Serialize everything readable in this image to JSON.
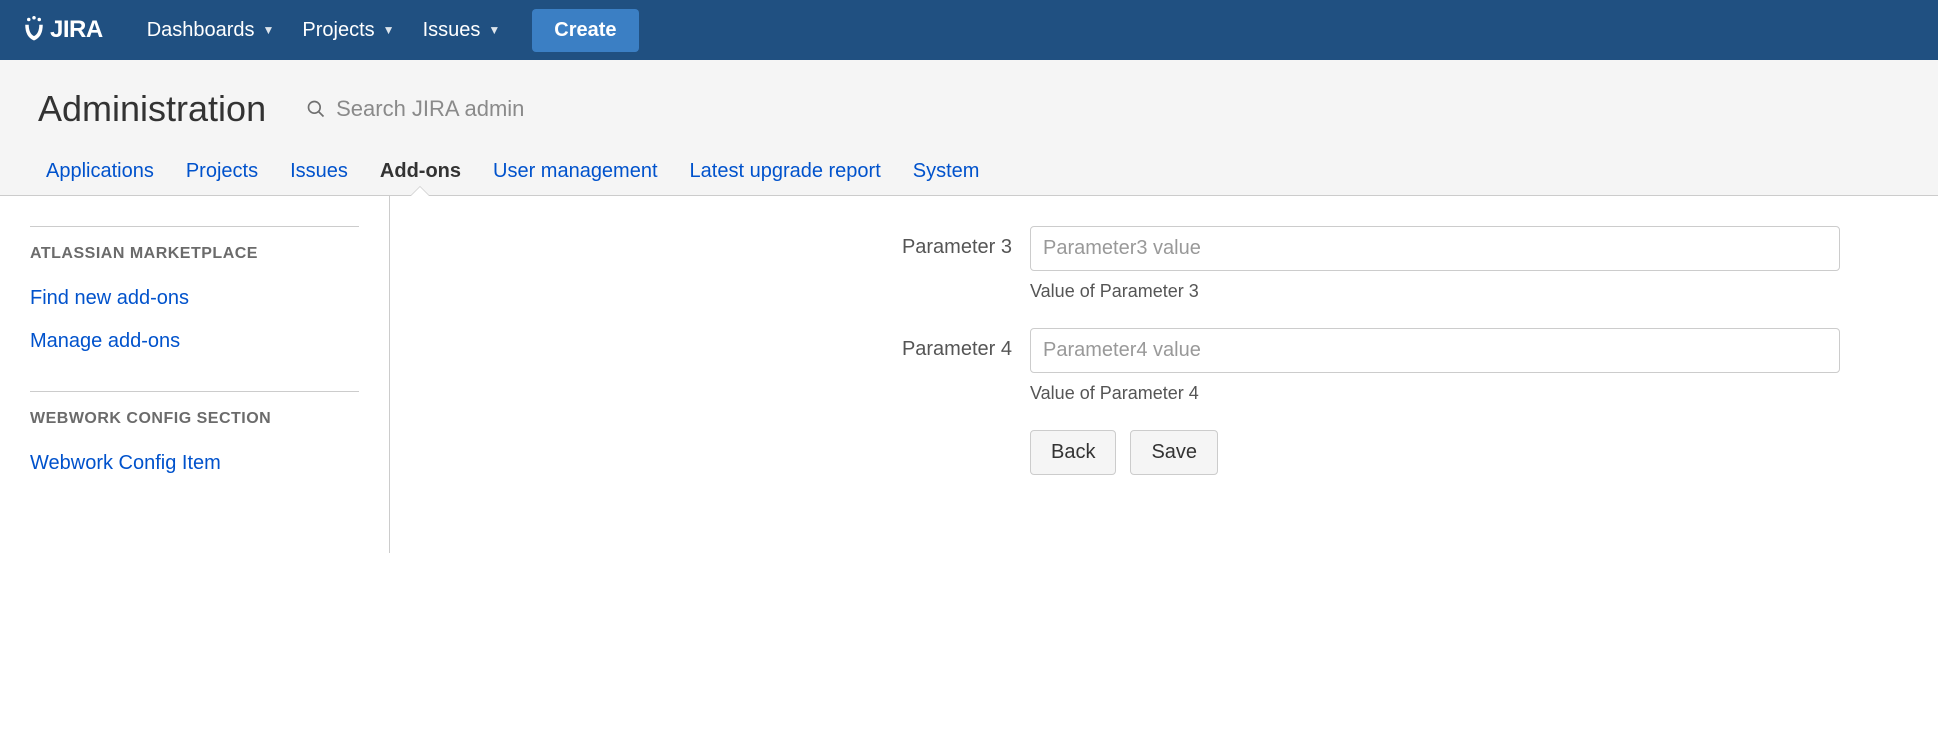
{
  "topnav": {
    "logo_text": "JIRA",
    "items": [
      {
        "label": "Dashboards"
      },
      {
        "label": "Projects"
      },
      {
        "label": "Issues"
      }
    ],
    "create_label": "Create"
  },
  "admin": {
    "title": "Administration",
    "search_placeholder": "Search JIRA admin",
    "tabs": [
      {
        "label": "Applications",
        "active": false
      },
      {
        "label": "Projects",
        "active": false
      },
      {
        "label": "Issues",
        "active": false
      },
      {
        "label": "Add-ons",
        "active": true
      },
      {
        "label": "User management",
        "active": false
      },
      {
        "label": "Latest upgrade report",
        "active": false
      },
      {
        "label": "System",
        "active": false
      }
    ]
  },
  "sidebar": {
    "sections": [
      {
        "heading": "ATLASSIAN MARKETPLACE",
        "links": [
          {
            "label": "Find new add-ons"
          },
          {
            "label": "Manage add-ons"
          }
        ]
      },
      {
        "heading": "WEBWORK CONFIG SECTION",
        "links": [
          {
            "label": "Webwork Config Item"
          }
        ]
      }
    ]
  },
  "form": {
    "fields": [
      {
        "label": "Parameter 3",
        "placeholder": "Parameter3 value",
        "desc": "Value of Parameter 3"
      },
      {
        "label": "Parameter 4",
        "placeholder": "Parameter4 value",
        "desc": "Value of Parameter 4"
      }
    ],
    "buttons": {
      "back": "Back",
      "save": "Save"
    }
  }
}
